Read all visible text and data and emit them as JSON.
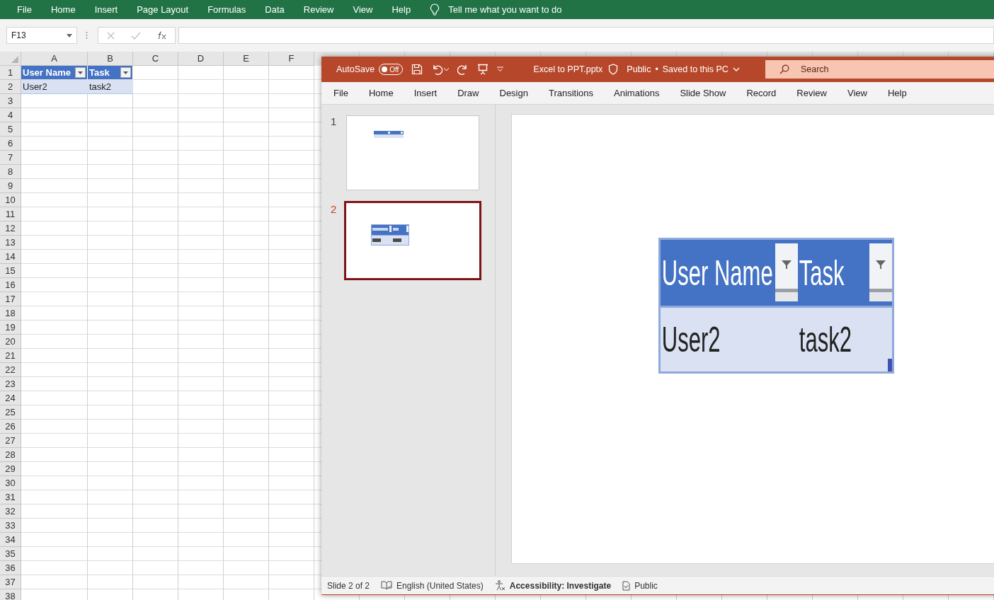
{
  "excel": {
    "menu": [
      "File",
      "Home",
      "Insert",
      "Page Layout",
      "Formulas",
      "Data",
      "Review",
      "View",
      "Help"
    ],
    "tell_me": "Tell me what you want to do",
    "name_box": "F13",
    "columns": [
      "A",
      "B",
      "C",
      "D",
      "E",
      "F"
    ],
    "row_numbers": [
      "1",
      "2",
      "3",
      "4",
      "5",
      "6",
      "7",
      "8",
      "9",
      "10",
      "11",
      "12",
      "13",
      "14",
      "15",
      "16",
      "17",
      "18",
      "19",
      "20",
      "21",
      "22",
      "23",
      "24",
      "25",
      "26",
      "27",
      "28",
      "29",
      "30",
      "31",
      "32",
      "33",
      "34",
      "35",
      "36",
      "37",
      "38"
    ],
    "table": {
      "headers": [
        "User Name",
        "Task"
      ],
      "rows": [
        [
          "User2",
          "task2"
        ]
      ]
    }
  },
  "powerpoint": {
    "autosave": {
      "label": "AutoSave",
      "on": false,
      "state_text": "Off"
    },
    "file_name": "Excel to PPT.pptx",
    "sensitivity": "Public",
    "separator": "•",
    "save_status": "Saved to this PC",
    "search": {
      "placeholder": "Search"
    },
    "tabs": [
      "File",
      "Home",
      "Insert",
      "Draw",
      "Design",
      "Transitions",
      "Animations",
      "Slide Show",
      "Record",
      "Review",
      "View",
      "Help"
    ],
    "slides": [
      {
        "number": "1",
        "selected": false
      },
      {
        "number": "2",
        "selected": true
      }
    ],
    "slide_table": {
      "headers": [
        "User Name",
        "Task"
      ],
      "rows": [
        [
          "User2",
          "task2"
        ]
      ]
    },
    "status_bar": {
      "slide": "Slide 2 of 2",
      "language": "English (United States)",
      "accessibility": "Accessibility: Investigate",
      "sensitivity": "Public"
    }
  }
}
